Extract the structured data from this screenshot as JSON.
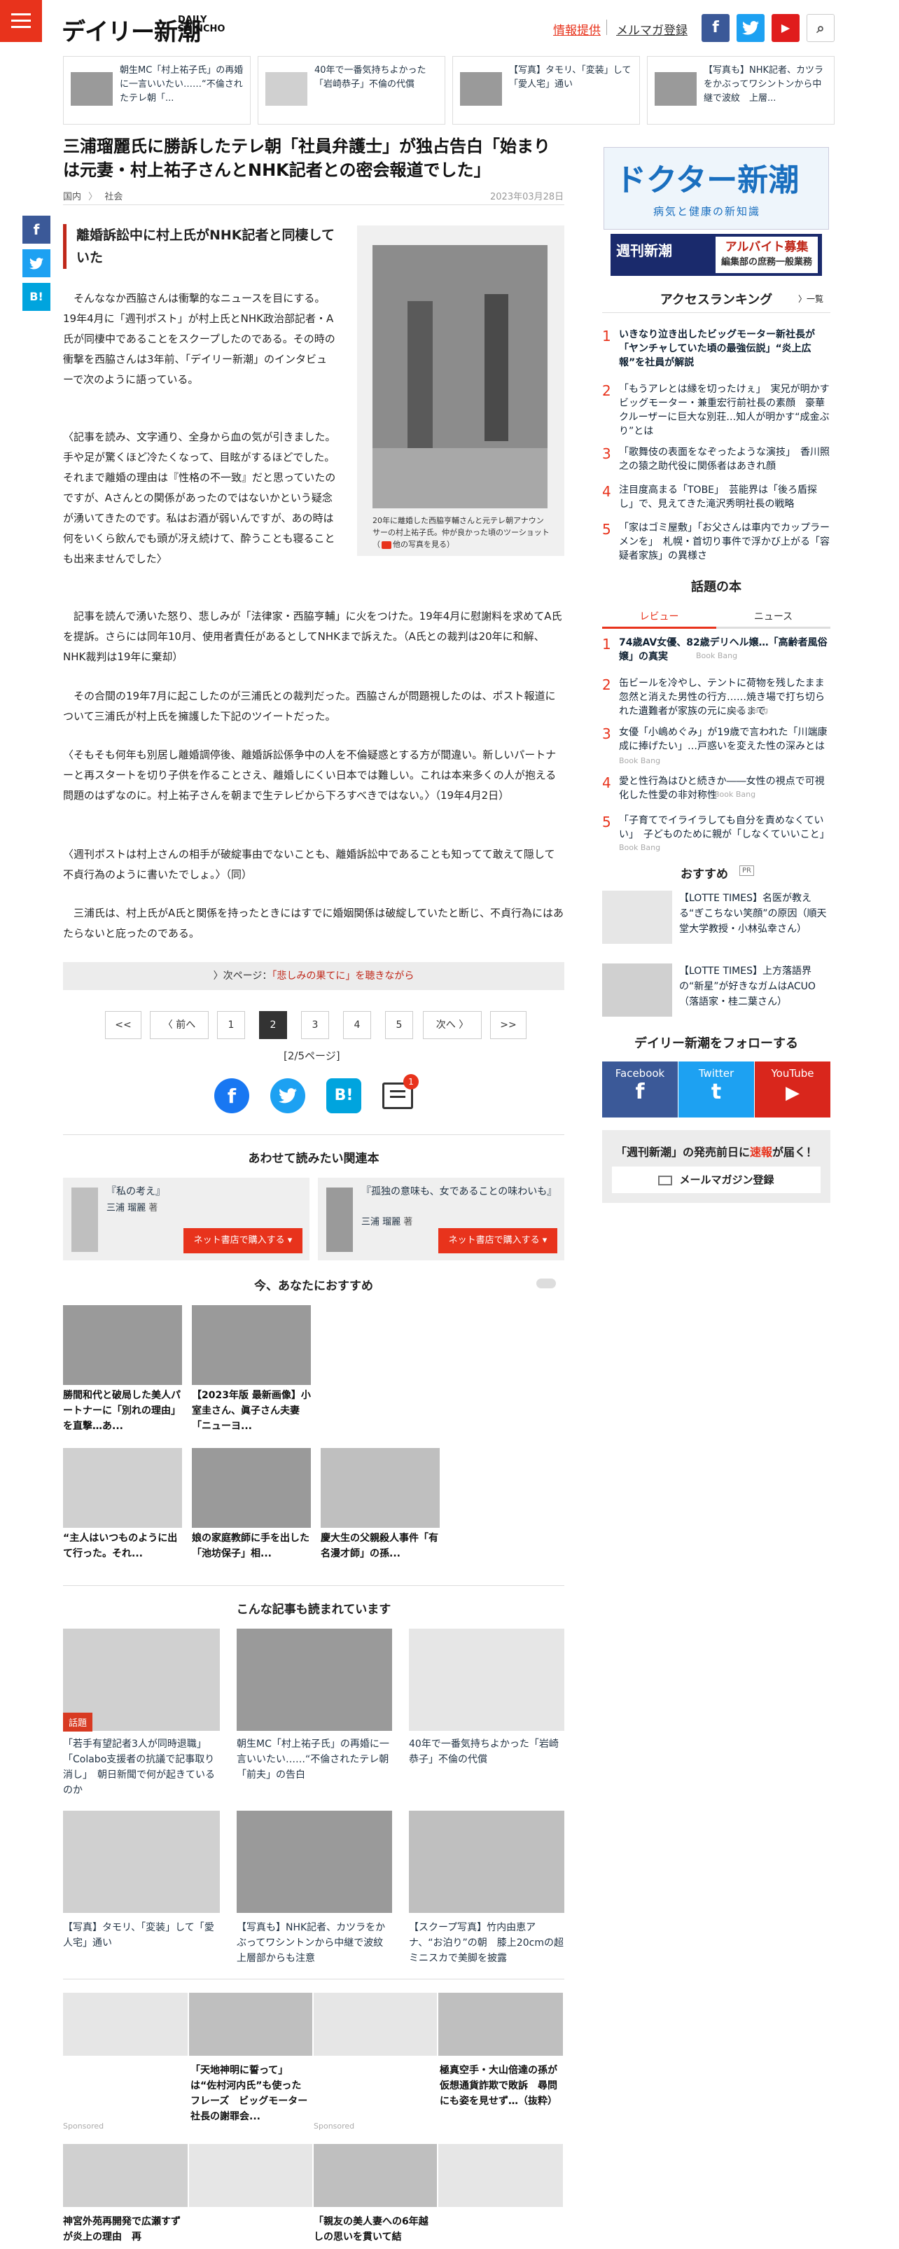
{
  "header": {
    "logo": "デイリー新潮",
    "logo_sub_1": "DAILY",
    "logo_sub_2": "SHINCHO",
    "info_link": "情報提供",
    "mail_link": "メルマガ登録",
    "facebook": "f",
    "youtube": "▶",
    "search": "⌕"
  },
  "strip": [
    {
      "text": "朝生MC「村上祐子氏」の再婚に一言いいたい……“不倫されたテレ朝「..."
    },
    {
      "text": "40年で一番気持ちよかった「岩崎恭子」不倫の代償"
    },
    {
      "text": "【写真】タモリ、「変装」して「愛人宅」通い"
    },
    {
      "text": "【写真も】NHK記者、カツラをかぶってワシントンから中継で波紋　上層..."
    }
  ],
  "article": {
    "title": "三浦瑠麗氏に勝訴したテレ朝「社員弁護士」が独占告白「始まりは元妻・村上祐子さんとNHK記者との密会報道でした」",
    "crumb_1": "国内",
    "crumb_sep": "〉",
    "crumb_2": "社会",
    "date": "2023年03月28日",
    "subheading": "離婚訴訟中に村上氏がNHK記者と同棲していた",
    "photo_caption": "20年に離婚した西脇亨輔さんと元テレ朝アナウンサーの村上祐子氏。仲が良かった頃のツーショット（",
    "photo_caption_link": "他の写真を見る",
    "photo_caption_end": "）",
    "p1": "そんななか西脇さんは衝撃的なニュースを目にする。19年4月に「週刊ポスト」が村上氏とNHK政治部記者・A氏が同棲中であることをスクープしたのである。その時の衝撃を西脇さんは3年前、「デイリー新潮」のインタビューで次のように語っている。",
    "p2": "〈記事を読み、文字通り、全身から血の気が引きました。手や足が驚くほど冷たくなって、目眩がするほどでした。それまで離婚の理由は『性格の不一致』だと思っていたのですが、Aさんとの関係があったのではないかという疑念が湧いてきたのです。私はお酒が弱いんですが、あの時は何をいくら飲んでも頭が冴え続けて、酔うことも寝ることも出来ませんでした〉",
    "p3": "記事を読んで湧いた怒り、悲しみが「法律家・西脇亨輔」に火をつけた。19年4月に慰謝料を求めてA氏を提訴。さらには同年10月、使用者責任があるとしてNHKまで訴えた。（A氏との裁判は20年に和解、NHK裁判は19年に棄却）",
    "p4": "その合間の19年7月に起こしたのが三浦氏との裁判だった。西脇さんが問題視したのは、ポスト報道について三浦氏が村上氏を擁護した下記のツイートだった。",
    "p5": "〈そもそも何年も別居し離婚調停後、離婚訴訟係争中の人を不倫疑惑とする方が間違い。新しいパートナーと再スタートを切り子供を作ることさえ、離婚しにくい日本では難しい。これは本来多くの人が抱える問題のはずなのに。村上祐子さんを朝まで生テレビから下ろすべきではない。〉（19年4月2日）",
    "p6": "〈週刊ポストは村上さんの相手が破綻事由でないことも、離婚訴訟中であることも知ってて敢えて隠して不貞行為のように書いたでしょ。〉（同）",
    "p7": "三浦氏は、村上氏がA氏と関係を持ったときにはすでに婚姻関係は破綻していたと断じ、不貞行為にはあたらないと庇ったのである。",
    "next_prefix": "〉次ページ：",
    "next_title": "「悲しみの果てに」を聴きながら",
    "pagination": {
      "first": "<<",
      "prev": "〈 前へ",
      "pages": [
        "1",
        "2",
        "3",
        "4",
        "5"
      ],
      "next": "次へ 〉",
      "last": ">>",
      "count": "[2/5ページ]"
    },
    "comment_badge": "1"
  },
  "related": {
    "heading": "あわせて読みたい関連本",
    "books": [
      {
        "title": "『私の考え』",
        "author": "三浦 瑠麗",
        "author_suffix": "著",
        "buy": "ネット書店で購入する ▾"
      },
      {
        "title": "『孤独の意味も、女であることの味わいも』",
        "author": "三浦 瑠麗",
        "author_suffix": "著",
        "buy": "ネット書店で購入する ▾"
      }
    ]
  },
  "recommend": {
    "heading": "今、あなたにおすすめ",
    "items": [
      {
        "text": "勝間和代と破局した美人パートナーに「別れの理由」を直撃…あ..."
      },
      {
        "text": "【2023年版 最新画像】小室圭さん、眞子さん夫妻「ニューヨ..."
      },
      {
        "text": "“主人はいつものように出て行った。それ..."
      },
      {
        "text": "娘の家庭教師に手を出した「池坊保子」相..."
      },
      {
        "text": "慶大生の父親殺人事件「有名漫才師」の孫..."
      }
    ]
  },
  "also": {
    "heading": "こんな記事も読まれています",
    "tag": "話題",
    "items": [
      {
        "text": "「若手有望記者3人が同時退職」「Colabo支援者の抗議で記事取り消し」　朝日新聞で何が起きているのか"
      },
      {
        "text": "朝生MC「村上祐子氏」の再婚に一言いいたい……“不倫されたテレ朝「前夫」の告白"
      },
      {
        "text": "40年で一番気持ちよかった「岩崎恭子」不倫の代償"
      },
      {
        "text": "【写真】タモリ、「変装」して「愛人宅」通い"
      },
      {
        "text": "【写真も】NHK記者、カツラをかぶってワシントンから中継で波紋　上層部からも注意"
      },
      {
        "text": "【スクープ写真】竹内由恵アナ、“お泊り”の朝　膝上20cmの超ミニスカで美脚を披露"
      }
    ]
  },
  "bottom": {
    "sponsored": "Sponsored",
    "items": [
      {
        "text": "「天地神明に誓って」は“佐村河内氏”も使ったフレーズ　ビッグモーター社長の謝罪会..."
      },
      {
        "text": "極真空手・大山倍達の孫が仮想通貨詐欺で敗訴　尋問にも姿を見せず…（抜粋）"
      },
      {
        "text": "神宮外苑再開発で広瀬すずが炎上の理由　再"
      },
      {
        "text": "「親友の美人妻への6年越しの思いを貫いて結"
      }
    ]
  },
  "sidebar": {
    "ad1_title": "ドクター新潮",
    "ad1_sub": "病気と健康の新知識",
    "ad2_left": "週刊新潮",
    "ad2_right": "アルバイト募集",
    "ad2_small": "編集部の庶務一般業務",
    "ranking_title": "アクセスランキング",
    "ranking_more": "〉一覧",
    "ranking": [
      {
        "no": "1",
        "text": "いきなり泣き出したビッグモーター新社長が「ヤンチャしていた頃の最強伝説」“炎上広報”を社員が解説"
      },
      {
        "no": "2",
        "text": "「もうアレとは縁を切ったけぇ」　実兄が明かすビッグモーター・兼重宏行前社長の素顔　豪華クルーザーに巨大な別荘…知人が明かす“成金ぶり”とは"
      },
      {
        "no": "3",
        "text": "「歌舞伎の表面をなぞったような演技」　香川照之の猿之助代役に関係者はあきれ顔"
      },
      {
        "no": "4",
        "text": "注目度高まる「TOBE」　芸能界は「後ろ盾探し」で、見えてきた滝沢秀明社長の戦略"
      },
      {
        "no": "5",
        "text": "「家はゴミ屋敷」「お父さんは車内でカップラーメンを」　札幌・首切り事件で浮かび上がる「容疑者家族」の異様さ"
      }
    ],
    "book_title": "話題の本",
    "tab_review": "レビュー",
    "tab_news": "ニュース",
    "book_source": "Book Bang",
    "books": [
      {
        "no": "1",
        "text": "74歳AV女優、82歳デリヘル嬢…「高齢者風俗嬢」の真実"
      },
      {
        "no": "2",
        "text": "缶ビールを冷やし、テントに荷物を残したまま忽然と消えた男性の行方……焼き場で打ち切られた遺難者が家族の元に戻るまで"
      },
      {
        "no": "3",
        "text": "女優「小嶋めぐみ」が19歳で言われた「川端康成に捧げたい」…戸惑いを変えた性の深みとは"
      },
      {
        "no": "4",
        "text": "愛と性行為はひと続きか――女性の視点で可視化した性愛の非対称性"
      },
      {
        "no": "5",
        "text": "「子育てでイライラしても自分を責めなくていい」　子どものために親が「しなくていいこと」"
      }
    ],
    "osusume_title": "おすすめ",
    "pr": "PR",
    "osusume": [
      {
        "text": "【LOTTE TIMES】名医が教える“ぎこちない笑顔”の原因（順天堂大学教授・小林弘幸さん）"
      },
      {
        "text": "【LOTTE TIMES】上方落語界の“新星”が好きなガムはACUO（落語家・桂二葉さん）"
      }
    ],
    "follow_title": "デイリー新潮をフォローする",
    "follow": [
      {
        "name": "Facebook",
        "icon": "f"
      },
      {
        "name": "Twitter",
        "icon": "t"
      },
      {
        "name": "YouTube",
        "icon": "▶"
      }
    ],
    "mm_pre": "「週刊新潮」の発売前日に",
    "mm_em": "速報",
    "mm_post": "が届く！",
    "mm_button": "メールマガジン登録"
  },
  "share": {
    "facebook": "f",
    "twitter": "t",
    "hatena": "B!"
  }
}
